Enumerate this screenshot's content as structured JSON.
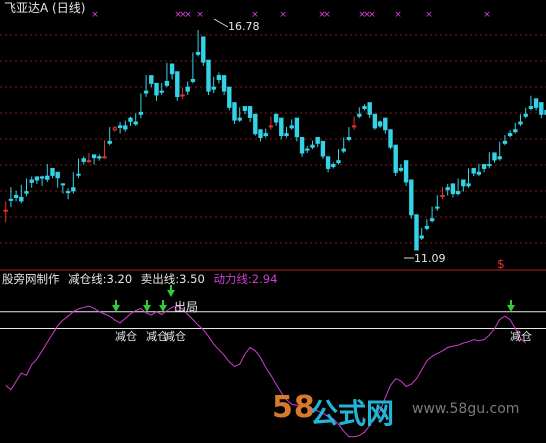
{
  "title": "飞亚达A (日线)",
  "indicator": {
    "name": "股旁网制作",
    "params": [
      {
        "label": "减仓线:3.20",
        "color": "#e6e6e6"
      },
      {
        "label": "卖出线:3.50",
        "color": "#e6e6e6"
      },
      {
        "label": "动力线:2.94",
        "color": "#d23ed2"
      }
    ]
  },
  "price_labels": {
    "high": "16.78",
    "low": "11.09"
  },
  "signal_labels": {
    "exit": "出局",
    "reduce": "减仓"
  },
  "watermark": {
    "brand_num": "58",
    "brand_text": "公式网",
    "url": "www.58gu.com"
  },
  "colors": {
    "up": "#e0322f",
    "down": "#35d3e6",
    "power": "#d23ed2",
    "grid": "#8a1d1d",
    "arrow": "#2ecc3a",
    "marker": "#e040e0"
  },
  "chart_data": {
    "type": "candlestick",
    "ylim": [
      11.09,
      16.78
    ],
    "candles": [
      [
        12.12,
        12.35,
        12.12,
        11.8
      ],
      [
        12.4,
        12.72,
        12.38,
        12.2
      ],
      [
        12.5,
        12.62,
        12.45,
        12.35
      ],
      [
        12.45,
        12.78,
        12.36,
        12.3
      ],
      [
        12.6,
        12.94,
        12.56,
        12.48
      ],
      [
        12.9,
        12.99,
        12.84,
        12.7
      ],
      [
        12.98,
        12.93,
        12.9,
        12.8
      ],
      [
        12.98,
        13.01,
        12.95,
        12.75
      ],
      [
        13.0,
        13.31,
        12.92,
        12.85
      ],
      [
        13.2,
        13.16,
        13.02,
        12.95
      ],
      [
        13.1,
        12.98,
        12.96,
        12.7
      ],
      [
        12.8,
        12.82,
        12.79,
        12.55
      ],
      [
        12.6,
        12.69,
        12.58,
        12.4
      ],
      [
        12.7,
        13.1,
        12.62,
        12.55
      ],
      [
        13.05,
        13.45,
        13.04,
        12.95
      ],
      [
        13.45,
        13.51,
        13.38,
        13.3
      ],
      [
        13.4,
        13.6,
        13.4,
        13.35
      ],
      [
        13.55,
        13.53,
        13.48,
        13.3
      ],
      [
        13.5,
        13.56,
        13.47,
        13.4
      ],
      [
        13.5,
        13.93,
        13.5,
        13.45
      ],
      [
        13.9,
        14.27,
        13.85,
        13.8
      ],
      [
        14.2,
        14.3,
        14.25,
        14.15
      ],
      [
        14.3,
        14.4,
        14.26,
        14.1
      ],
      [
        14.3,
        14.44,
        14.22,
        14.15
      ],
      [
        14.5,
        14.54,
        14.42,
        14.3
      ],
      [
        14.4,
        14.62,
        14.35,
        14.3
      ],
      [
        14.65,
        15.14,
        14.6,
        14.5
      ],
      [
        15.2,
        15.61,
        15.15,
        15.05
      ],
      [
        15.6,
        15.49,
        15.4,
        15.3
      ],
      [
        15.4,
        15.17,
        15.1,
        14.95
      ],
      [
        15.2,
        15.41,
        15.17,
        15.1
      ],
      [
        15.45,
        15.93,
        15.35,
        15.3
      ],
      [
        15.9,
        15.71,
        15.65,
        15.5
      ],
      [
        15.7,
        15.12,
        15.06,
        14.95
      ],
      [
        15.1,
        15.29,
        15.1,
        15.0
      ],
      [
        15.3,
        15.45,
        15.2,
        15.1
      ],
      [
        15.5,
        16.2,
        15.45,
        15.4
      ],
      [
        16.2,
        16.78,
        16.15,
        16.1
      ],
      [
        16.6,
        16.12,
        15.95,
        15.85
      ],
      [
        16.0,
        15.25,
        15.2,
        15.1
      ],
      [
        15.3,
        15.57,
        15.25,
        15.15
      ],
      [
        15.6,
        15.68,
        15.5,
        15.4
      ],
      [
        15.6,
        15.27,
        15.2,
        15.1
      ],
      [
        15.3,
        14.89,
        14.78,
        14.7
      ],
      [
        14.9,
        14.51,
        14.45,
        14.35
      ],
      [
        14.5,
        14.78,
        14.45,
        14.4
      ],
      [
        14.8,
        14.78,
        14.7,
        14.6
      ],
      [
        14.8,
        14.6,
        14.52,
        14.4
      ],
      [
        14.6,
        14.25,
        14.1,
        14.05
      ],
      [
        14.2,
        14.13,
        14.0,
        13.9
      ],
      [
        14.1,
        14.23,
        14.05,
        14.0
      ],
      [
        14.3,
        14.54,
        14.3,
        14.2
      ],
      [
        14.6,
        14.54,
        14.4,
        14.3
      ],
      [
        14.5,
        14.14,
        14.05,
        13.95
      ],
      [
        14.1,
        14.27,
        14.05,
        14.0
      ],
      [
        14.3,
        14.47,
        14.25,
        14.2
      ],
      [
        14.5,
        14.1,
        14.02,
        13.9
      ],
      [
        14.0,
        13.73,
        13.6,
        13.5
      ],
      [
        13.7,
        13.78,
        13.68,
        13.6
      ],
      [
        13.8,
        13.92,
        13.75,
        13.7
      ],
      [
        14.0,
        13.9,
        13.85,
        13.75
      ],
      [
        13.9,
        13.65,
        13.52,
        13.45
      ],
      [
        13.5,
        13.31,
        13.2,
        13.1
      ],
      [
        13.3,
        13.36,
        13.25,
        13.2
      ],
      [
        13.4,
        13.7,
        13.35,
        13.3
      ],
      [
        13.7,
        14.0,
        13.65,
        13.6
      ],
      [
        14.0,
        14.27,
        13.95,
        13.9
      ],
      [
        14.3,
        14.54,
        14.3,
        14.2
      ],
      [
        14.6,
        14.78,
        14.55,
        14.5
      ],
      [
        14.8,
        14.86,
        14.75,
        14.7
      ],
      [
        14.9,
        14.69,
        14.6,
        14.5
      ],
      [
        14.6,
        14.36,
        14.25,
        14.2
      ],
      [
        14.4,
        14.44,
        14.3,
        14.25
      ],
      [
        14.5,
        14.32,
        14.2,
        14.1
      ],
      [
        14.2,
        13.88,
        13.75,
        13.7
      ],
      [
        13.8,
        13.2,
        13.1,
        13.0
      ],
      [
        13.2,
        13.31,
        13.15,
        13.1
      ],
      [
        13.4,
        12.93,
        12.85,
        12.75
      ],
      [
        12.9,
        12.1,
        12.0,
        11.9
      ],
      [
        12.0,
        11.45,
        11.09,
        11.35
      ],
      [
        11.45,
        11.66,
        11.4,
        11.35
      ],
      [
        11.7,
        11.89,
        11.65,
        11.6
      ],
      [
        11.9,
        12.21,
        11.85,
        11.8
      ],
      [
        12.2,
        12.51,
        12.18,
        12.1
      ],
      [
        12.5,
        12.72,
        12.5,
        12.4
      ],
      [
        12.7,
        12.8,
        12.65,
        12.5
      ],
      [
        12.8,
        12.61,
        12.55,
        12.45
      ],
      [
        12.6,
        12.94,
        12.55,
        12.5
      ],
      [
        12.9,
        12.83,
        12.75,
        12.6
      ],
      [
        12.8,
        13.2,
        12.75,
        12.7
      ],
      [
        13.2,
        13.15,
        13.08,
        13.0
      ],
      [
        13.1,
        13.32,
        13.05,
        13.0
      ],
      [
        13.3,
        13.26,
        13.2,
        13.1
      ],
      [
        13.3,
        13.62,
        13.28,
        13.2
      ],
      [
        13.6,
        13.5,
        13.42,
        13.35
      ],
      [
        13.5,
        13.89,
        13.45,
        13.4
      ],
      [
        13.9,
        14.06,
        13.85,
        13.8
      ],
      [
        14.1,
        14.19,
        14.05,
        14.0
      ],
      [
        14.2,
        14.38,
        14.15,
        14.1
      ],
      [
        14.4,
        14.6,
        14.35,
        14.3
      ],
      [
        14.6,
        14.77,
        14.55,
        14.5
      ],
      [
        14.8,
        15.08,
        14.75,
        14.7
      ],
      [
        15.0,
        14.9,
        14.78,
        14.7
      ],
      [
        14.9,
        14.69,
        14.6,
        14.5
      ],
      [
        14.7,
        14.78,
        14.6,
        14.55
      ],
      [
        14.8,
        14.58,
        14.45,
        14.4
      ]
    ],
    "power_line": {
      "name": "动力线",
      "values": [
        2.18,
        2.1,
        2.25,
        2.4,
        2.36,
        2.55,
        2.65,
        2.8,
        2.95,
        3.1,
        3.25,
        3.35,
        3.42,
        3.5,
        3.55,
        3.58,
        3.6,
        3.56,
        3.5,
        3.46,
        3.42,
        3.35,
        3.3,
        3.38,
        3.46,
        3.52,
        3.56,
        3.48,
        3.44,
        3.5,
        3.45,
        3.52,
        3.58,
        3.6,
        3.55,
        3.45,
        3.36,
        3.26,
        3.18,
        3.06,
        2.92,
        2.82,
        2.72,
        2.6,
        2.52,
        2.56,
        2.74,
        2.86,
        2.8,
        2.68,
        2.5,
        2.36,
        2.2,
        2.05,
        1.92,
        1.84,
        1.82,
        1.82,
        1.8,
        1.76,
        1.72,
        1.68,
        1.62,
        1.58,
        1.48,
        1.36,
        1.26,
        1.26,
        1.28,
        1.34,
        1.46,
        1.6,
        1.72,
        1.96,
        2.18,
        2.3,
        2.26,
        2.16,
        2.2,
        2.3,
        2.46,
        2.62,
        2.7,
        2.75,
        2.8,
        2.86,
        2.88,
        2.9,
        2.94,
        2.96,
        3.0,
        2.98,
        3.0,
        3.08,
        3.2,
        3.36,
        3.42,
        3.36,
        3.2,
        3.02,
        2.94
      ]
    },
    "threshold_lines": [
      {
        "name": "卖出线",
        "value": 3.5
      },
      {
        "name": "减仓线",
        "value": 3.2
      }
    ]
  }
}
